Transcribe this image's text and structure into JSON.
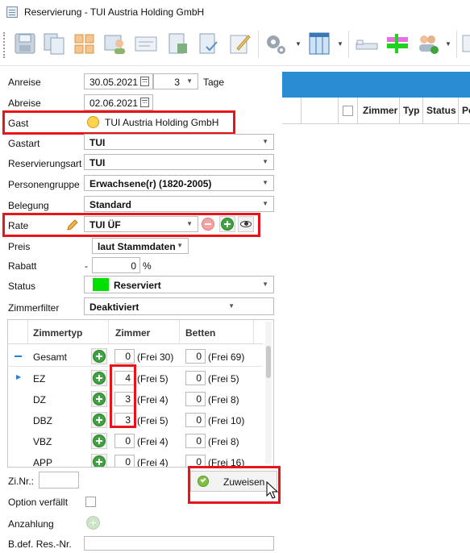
{
  "window": {
    "title": "Reservierung - TUI Austria Holding GmbH"
  },
  "form": {
    "anreise_label": "Anreise",
    "anreise_value": "30.05.2021",
    "nights_value": "3",
    "nights_unit": "Tage",
    "abreise_label": "Abreise",
    "abreise_value": "02.06.2021",
    "gast_label": "Gast",
    "gast_value": "TUI Austria Holding GmbH",
    "gastart_label": "Gastart",
    "gastart_value": "TUI",
    "reservierungsart_label": "Reservierungsart",
    "reservierungsart_value": "TUI",
    "personengruppe_label": "Personengruppe",
    "personengruppe_value": "Erwachsene(r) (1820-2005)",
    "belegung_label": "Belegung",
    "belegung_value": "Standard",
    "rate_label": "Rate",
    "rate_value": "TUI ÜF",
    "preis_label": "Preis",
    "preis_value": "laut Stammdaten",
    "rabatt_label": "Rabatt",
    "rabatt_prefix": "-",
    "rabatt_value": "0",
    "rabatt_unit": "%",
    "status_label": "Status",
    "status_value": "Reserviert",
    "status_color": "#00e000",
    "zimmerfilter_label": "Zimmerfilter",
    "zimmerfilter_value": "Deaktiviert"
  },
  "room_grid": {
    "headers": [
      "Zimmertyp",
      "Zimmer",
      "Betten"
    ],
    "total": {
      "label": "Gesamt",
      "zimmer": "0",
      "zimmer_frei": "(Frei 30)",
      "betten": "0",
      "betten_frei": "(Frei 69)"
    },
    "rows": [
      {
        "type": "EZ",
        "zimmer": "4",
        "zimmer_frei": "(Frei 5)",
        "betten": "0",
        "betten_frei": "(Frei 5)"
      },
      {
        "type": "DZ",
        "zimmer": "3",
        "zimmer_frei": "(Frei 4)",
        "betten": "0",
        "betten_frei": "(Frei 8)"
      },
      {
        "type": "DBZ",
        "zimmer": "3",
        "zimmer_frei": "(Frei 5)",
        "betten": "0",
        "betten_frei": "(Frei 10)"
      },
      {
        "type": "VBZ",
        "zimmer": "0",
        "zimmer_frei": "(Frei 4)",
        "betten": "0",
        "betten_frei": "(Frei 8)"
      },
      {
        "type": "APP",
        "zimmer": "0",
        "zimmer_frei": "(Frei 4)",
        "betten": "0",
        "betten_frei": "(Frei 16)"
      }
    ]
  },
  "bottom": {
    "zinr_label": "Zi.Nr.:",
    "zuweisen_label": "Zuweisen",
    "option_label": "Option verfällt",
    "anzahlung_label": "Anzahlung",
    "bdef_label": "B.def. Res.-Nr."
  },
  "right_grid": {
    "columns": [
      "Zimmer",
      "Typ",
      "Status",
      "Pe"
    ]
  },
  "toolbar": {
    "icons": [
      "save-icon",
      "copy-icon",
      "layout-icon",
      "guest-edit-icon",
      "card-icon",
      "export-icon",
      "document-check-icon",
      "edit-icon",
      "settings-icon",
      "columns-icon",
      "bed-icon",
      "room-plan-icon",
      "group-add-icon"
    ]
  }
}
